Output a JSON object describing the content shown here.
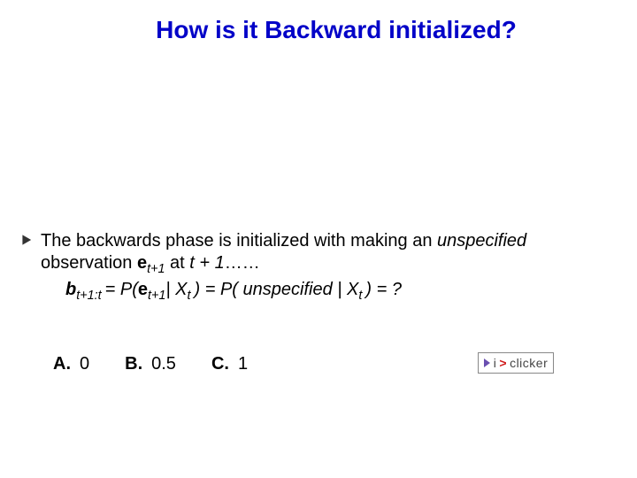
{
  "title": "How is it Backward initialized?",
  "bullet": {
    "line1_prefix": "The backwards phase is initialized with making an ",
    "unspecified": "unspecified",
    "line2_prefix": "observation ",
    "e_sym": "e",
    "e_sub": "t+1",
    "line2_at": " at  ",
    "t_plus_1": "t + 1",
    "dots": "……"
  },
  "formula": {
    "b_sym": "b",
    "b_sub": "t+1:t ",
    "eq1": " = P(",
    "e_sym": "e",
    "e_sub": "t+1",
    "mid": "| ",
    "X_sym": "X",
    "X_sub": "t ",
    "close1": ") = P( ",
    "unspec": "unspecified",
    "mid2": " | ",
    "X2_sym": "X",
    "X2_sub": "t ",
    "close2": ") = ?"
  },
  "answers": {
    "a_label": "A.",
    "a_value": "0",
    "b_label": "B.",
    "b_value": "0.5",
    "c_label": "C.",
    "c_value": "1"
  },
  "iclicker": {
    "pre": "i",
    "dash": ">",
    "post": "clicker"
  }
}
